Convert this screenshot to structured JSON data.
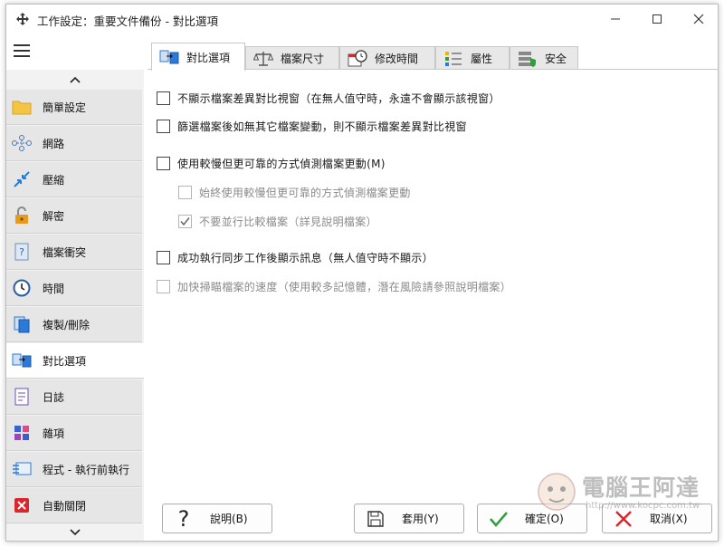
{
  "window": {
    "title": "工作設定：重要文件備份 - 對比選項"
  },
  "sidebar": {
    "items": [
      {
        "label": "簡單設定",
        "icon": "folder-icon"
      },
      {
        "label": "網路",
        "icon": "network-icon"
      },
      {
        "label": "壓縮",
        "icon": "compress-icon"
      },
      {
        "label": "解密",
        "icon": "unlock-icon"
      },
      {
        "label": "檔案衝突",
        "icon": "file-conflict-icon"
      },
      {
        "label": "時間",
        "icon": "clock-icon"
      },
      {
        "label": "複製/刪除",
        "icon": "copy-delete-icon"
      },
      {
        "label": "對比選項",
        "icon": "compare-icon",
        "active": true
      },
      {
        "label": "日誌",
        "icon": "log-icon"
      },
      {
        "label": "雜項",
        "icon": "misc-icon"
      },
      {
        "label": "程式 - 執行前執行",
        "icon": "program-icon"
      },
      {
        "label": "自動關閉",
        "icon": "auto-close-icon"
      }
    ]
  },
  "tabs": [
    {
      "label": "對比選項",
      "icon": "compare-icon",
      "active": true
    },
    {
      "label": "檔案尺寸",
      "icon": "scale-icon"
    },
    {
      "label": "修改時間",
      "icon": "clock-calendar-icon"
    },
    {
      "label": "屬性",
      "icon": "attributes-icon"
    },
    {
      "label": "安全",
      "icon": "security-icon"
    }
  ],
  "options": [
    {
      "label": "不顯示檔案差異對比視窗（在無人值守時，永遠不會顯示該視窗）",
      "checked": false,
      "enabled": true
    },
    {
      "label": "篩選檔案後如無其它檔案變動，則不顯示檔案差異對比視窗",
      "checked": false,
      "enabled": true
    },
    {
      "label": "使用較慢但更可靠的方式偵測檔案更動(M)",
      "checked": false,
      "enabled": true
    },
    {
      "label": "始終使用較慢但更可靠的方式偵測檔案更動",
      "checked": false,
      "enabled": false
    },
    {
      "label": "不要並行比較檔案（詳見說明檔案）",
      "checked": true,
      "enabled": false
    },
    {
      "label": "成功執行同步工作後顯示訊息（無人值守時不顯示）",
      "checked": false,
      "enabled": true
    },
    {
      "label": "加快掃瞄檔案的速度（使用較多記憶體，潛在風險請參照說明檔案）",
      "checked": false,
      "enabled": false
    }
  ],
  "buttons": {
    "help": "說明(B)",
    "apply": "套用(Y)",
    "ok": "確定(O)",
    "cancel": "取消(X)"
  },
  "watermark": {
    "text": "電腦王阿達",
    "url": "http://www.kocpc.com.tw"
  },
  "colors": {
    "accent_blue": "#2b79d8",
    "ok_green": "#2e9e3e",
    "cancel_red": "#d9262c",
    "folder_yellow": "#f4c542"
  }
}
